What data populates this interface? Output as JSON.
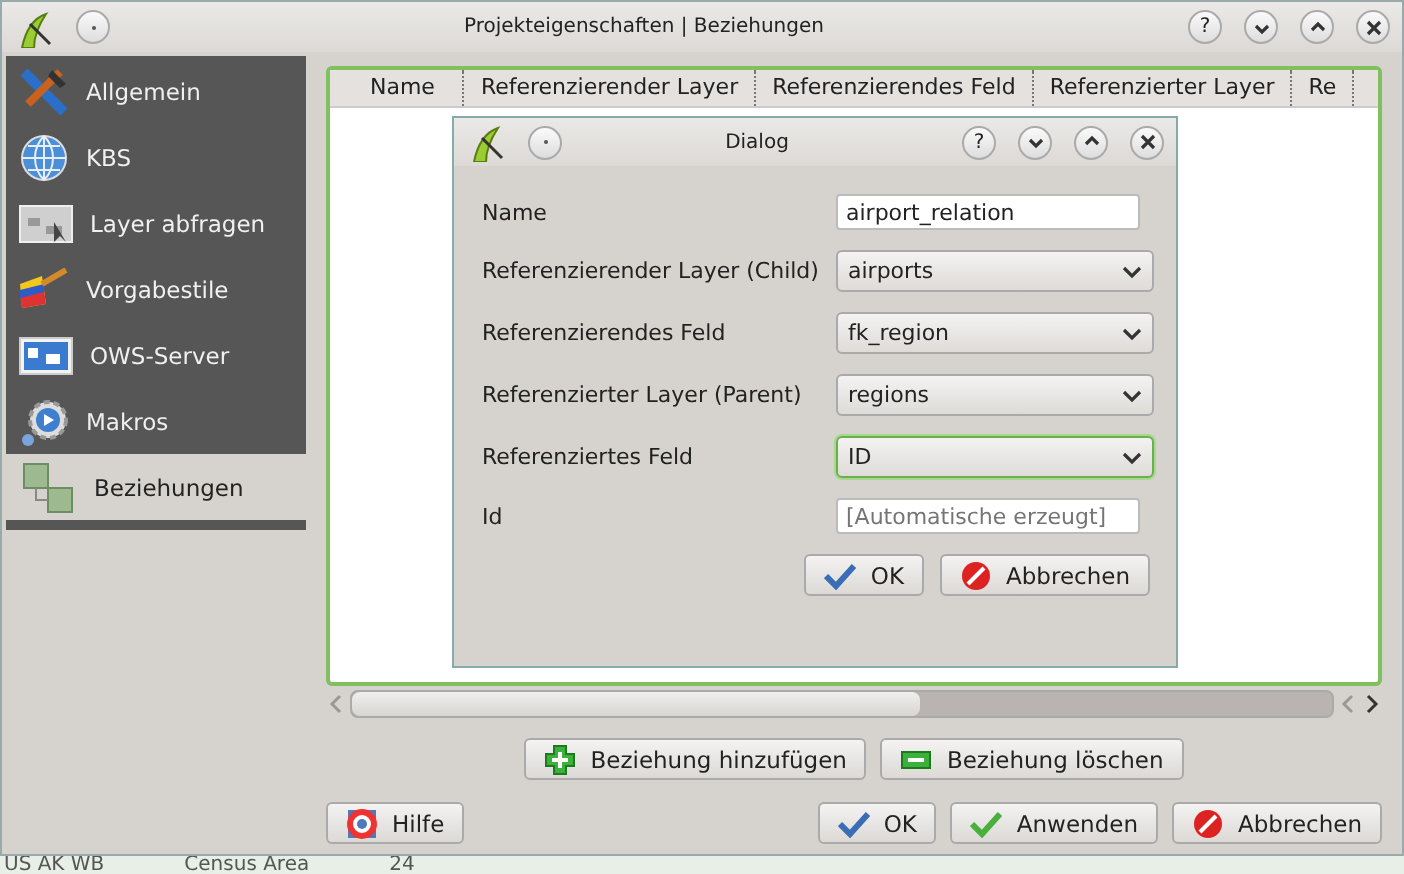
{
  "window": {
    "title": "Projekteigenschaften | Beziehungen",
    "help_button": "?"
  },
  "sidebar": {
    "items": [
      {
        "label": "Allgemein",
        "selected": false
      },
      {
        "label": "KBS",
        "selected": false
      },
      {
        "label": "Layer abfragen",
        "selected": false
      },
      {
        "label": "Vorgabestile",
        "selected": false
      },
      {
        "label": "OWS-Server",
        "selected": false
      },
      {
        "label": "Makros",
        "selected": false
      },
      {
        "label": "Beziehungen",
        "selected": true
      }
    ]
  },
  "table": {
    "columns": [
      "Name",
      "Referenzierender Layer",
      "Referenzierendes Feld",
      "Referenzierter Layer",
      "Re"
    ]
  },
  "dialog": {
    "title": "Dialog",
    "help_button": "?",
    "fields": [
      {
        "label": "Name",
        "kind": "text",
        "value": "airport_relation"
      },
      {
        "label": "Referenzierender Layer (Child)",
        "kind": "combo",
        "value": "airports",
        "focused": false
      },
      {
        "label": "Referenzierendes Feld",
        "kind": "combo",
        "value": "fk_region",
        "focused": false
      },
      {
        "label": "Referenzierter Layer (Parent)",
        "kind": "combo",
        "value": "regions",
        "focused": false
      },
      {
        "label": "Referenziertes Feld",
        "kind": "combo",
        "value": "ID",
        "focused": true
      },
      {
        "label": "Id",
        "kind": "text",
        "placeholder": "[Automatische erzeugt]"
      }
    ],
    "buttons": [
      {
        "label": "OK",
        "kind": "ok"
      },
      {
        "label": "Abbrechen",
        "kind": "cancel"
      }
    ]
  },
  "relation_buttons": [
    {
      "label": "Beziehung hinzufügen",
      "kind": "add"
    },
    {
      "label": "Beziehung löschen",
      "kind": "remove"
    }
  ],
  "help_button": {
    "label": "Hilfe"
  },
  "footer_buttons": [
    {
      "label": "OK",
      "kind": "ok"
    },
    {
      "label": "Anwenden",
      "kind": "apply"
    },
    {
      "label": "Abbrechen",
      "kind": "cancel"
    }
  ],
  "background": {
    "cells": [
      "US AK WB",
      "Census Area",
      "24"
    ]
  }
}
